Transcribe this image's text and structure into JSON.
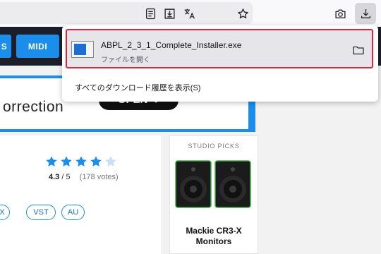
{
  "nav": {
    "buttons": [
      "S",
      "MIDI"
    ]
  },
  "banner": {
    "text": "orrection",
    "button_label": "OPEN ➜"
  },
  "rating": {
    "stars": 4,
    "max_stars": 5,
    "score": "4.3",
    "score_max": "/ 5",
    "votes": "(178 votes)"
  },
  "formats": [
    "X",
    "VST",
    "AU"
  ],
  "picks": {
    "heading": "STUDIO PICKS",
    "product_title": "Mackie CR3-X Monitors"
  },
  "downloads": {
    "file_name": "ABPL_2_3_1_Complete_Installer.exe",
    "status": "ファイルを開く",
    "show_all": "すべてのダウンロード履歴を表示(S)"
  },
  "colors": {
    "accent": "#1a8eea",
    "nav_bg": "#1a1f29",
    "highlight_border": "#e0243a",
    "star_filled": "#1a8eea",
    "star_empty": "#c8dff5"
  },
  "icons": [
    "reader-view-icon",
    "save-page-icon",
    "translate-icon",
    "bookmark-star-icon",
    "screenshot-icon",
    "download-icon",
    "folder-icon"
  ]
}
